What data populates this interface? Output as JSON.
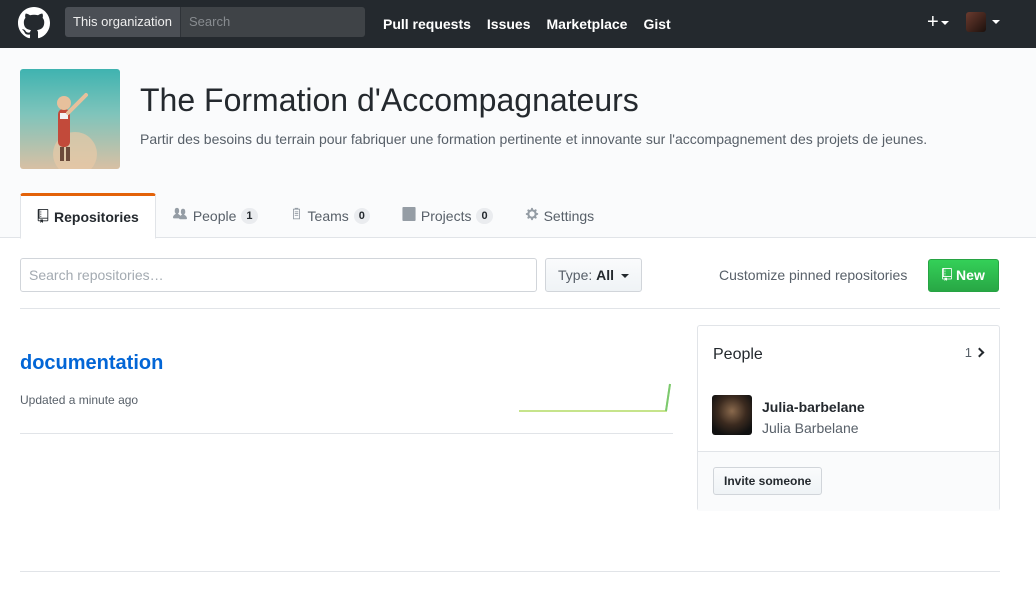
{
  "header": {
    "logo_icon": "github-octocat-icon",
    "scope_label": "This organization",
    "search_placeholder": "Search",
    "nav": [
      "Pull requests",
      "Issues",
      "Marketplace",
      "Gist"
    ],
    "plus_icon": "+"
  },
  "org": {
    "name": "The Formation d'Accompagnateurs",
    "description": "Partir des besoins du terrain pour fabriquer une formation pertinente et innovante sur l'accompagnement des projets de jeunes."
  },
  "tabs": [
    {
      "label": "Repositories",
      "icon": "repo-icon",
      "count": ""
    },
    {
      "label": "People",
      "icon": "people-icon",
      "count": "1"
    },
    {
      "label": "Teams",
      "icon": "teams-icon",
      "count": "0"
    },
    {
      "label": "Projects",
      "icon": "projects-icon",
      "count": "0"
    },
    {
      "label": "Settings",
      "icon": "gear-icon",
      "count": ""
    }
  ],
  "filter": {
    "search_placeholder": "Search repositories…",
    "type_label": "Type:",
    "type_value": "All",
    "customize": "Customize pinned repositories",
    "new_label": "New"
  },
  "repos": [
    {
      "name": "documentation",
      "updated": "Updated a minute ago"
    }
  ],
  "people": {
    "title": "People",
    "count": "1",
    "members": [
      {
        "login": "Julia-barbelane",
        "name": "Julia Barbelane"
      }
    ],
    "invite_label": "Invite someone"
  },
  "colors": {
    "header_bg": "#24292e",
    "link": "#0366d6",
    "new_button": "#28a745",
    "active_tab_accent": "#e36209"
  }
}
